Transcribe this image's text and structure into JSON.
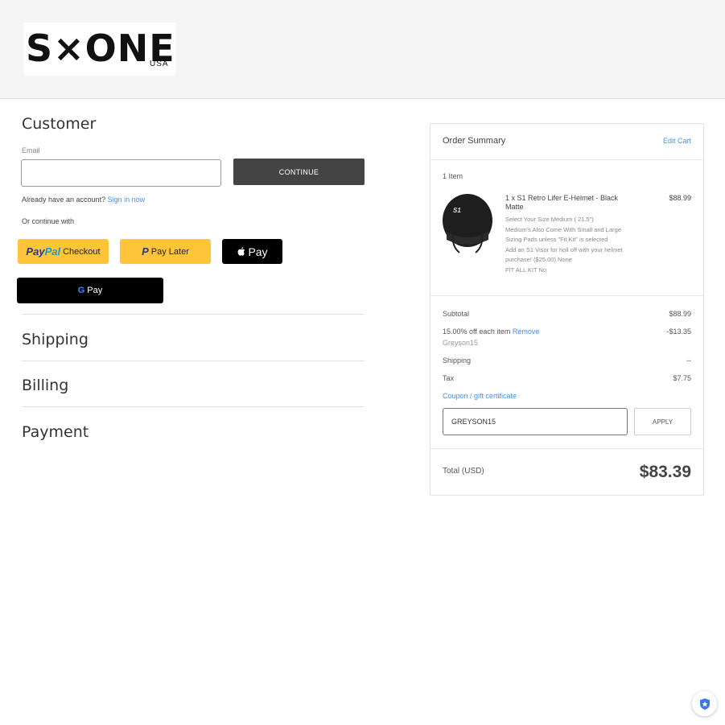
{
  "brand": {
    "logo_text": "S×ONE",
    "logo_sub": "USA"
  },
  "customer": {
    "heading": "Customer",
    "email_label": "Email",
    "email_value": "",
    "continue_label": "CONTINUE",
    "account_prompt": "Already have an account?",
    "sign_in_label": "Sign in now",
    "continue_with": "Or continue with",
    "paypal_word1": "Pay",
    "paypal_word2": "Pal",
    "paypal_checkout": "Checkout",
    "paylater_label": "Pay Later",
    "applepay_label": "Pay",
    "gpay_label": "Pay"
  },
  "sections": {
    "shipping": "Shipping",
    "billing": "Billing",
    "payment": "Payment"
  },
  "summary": {
    "title": "Order Summary",
    "edit_cart": "Edit Cart",
    "item_count": "1 Item",
    "item": {
      "title": "1 x S1 Retro Lifer E-Helmet - Black Matte",
      "price": "$88.99",
      "option1": "Select Your Size Medium ( 21.5\")",
      "option2": "Medium's Also Come With Small and Large Sizing Pads unless \"Fit Kit\" is selected",
      "option3": "Add an S1 Visor for holl off with your helmet purchase! ($25.00) None",
      "option4": "FIT ALL KIT No"
    },
    "subtotal_label": "Subtotal",
    "subtotal_value": "$88.99",
    "discount_label": "15.00% off each item",
    "discount_remove": "Remove",
    "discount_code": "Greyson15",
    "discount_value": "-$13.35",
    "shipping_label": "Shipping",
    "shipping_value": "--",
    "tax_label": "Tax",
    "tax_value": "$7.75",
    "coupon_label": "Coupon / gift certificate",
    "coupon_value": "GREYSON15",
    "apply_label": "APPLY",
    "total_label": "Total (USD)",
    "total_value": "$83.39"
  },
  "colors": {
    "accent": "#4a90e2",
    "button_dark": "#444444",
    "paypal_yellow": "#ffc439"
  }
}
